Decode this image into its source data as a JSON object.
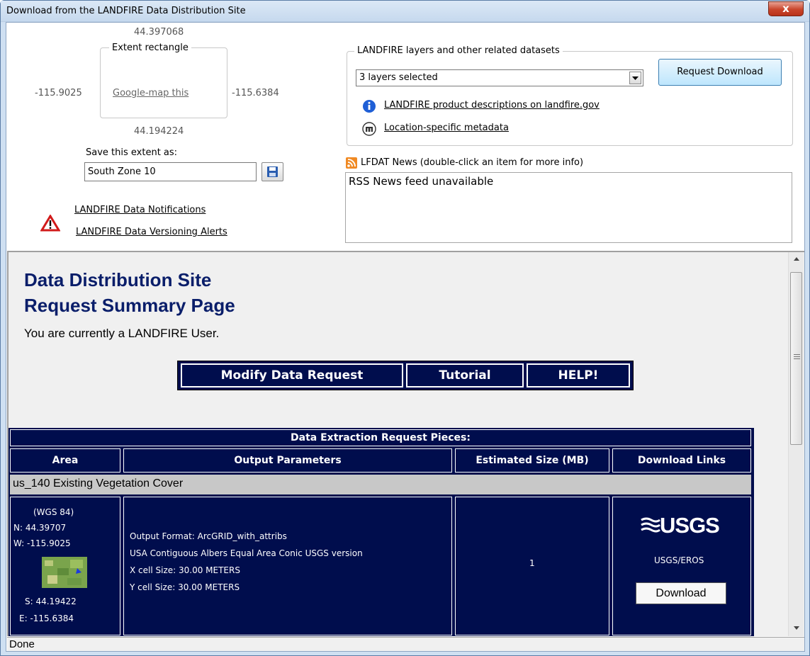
{
  "window": {
    "title": "Download from the LANDFIRE Data Distribution Site",
    "close_label": "x"
  },
  "extent": {
    "north": "44.397068",
    "south": "44.194224",
    "west": "-115.9025",
    "east": "-115.6384",
    "box_label": "Extent rectangle",
    "map_link": "Google-map this",
    "save_label": "Save this extent as:",
    "save_value": "South Zone 10"
  },
  "alerts": {
    "notifications": "LANDFIRE Data Notifications",
    "versioning": "LANDFIRE Data Versioning Alerts"
  },
  "layers": {
    "legend": "LANDFIRE layers and other related datasets",
    "selected": "3 layers selected",
    "request_button": "Request Download",
    "descriptions_link": "LANDFIRE product descriptions on landfire.gov",
    "metadata_link": "Location-specific metadata"
  },
  "news": {
    "label": "LFDAT News (double-click an item for more info)",
    "content": "RSS News feed unavailable"
  },
  "page": {
    "title_line1": "Data Distribution Site",
    "title_line2": "Request Summary Page",
    "user_line": "You are currently a LANDFIRE User.",
    "nav": {
      "modify": "Modify Data Request",
      "tutorial": "Tutorial",
      "help": "HELP!"
    }
  },
  "table": {
    "caption": "Data Extraction Request Pieces:",
    "headers": [
      "Area",
      "Output Parameters",
      "Estimated Size (MB)",
      "Download Links"
    ],
    "layer_name": "us_140 Existing Vegetation Cover",
    "area": {
      "datum": "(WGS 84)",
      "n": "N: 44.39707",
      "w": "W: -115.9025",
      "s": "S: 44.19422",
      "e": "E: -115.6384"
    },
    "params": [
      "Output Format: ArcGRID_with_attribs",
      "USA Contiguous Albers Equal Area Conic USGS version",
      "X cell Size: 30.00 METERS",
      "Y cell Size: 30.00 METERS"
    ],
    "size": "1",
    "logo_text": "USGS",
    "provider": "USGS/EROS",
    "download_button": "Download"
  },
  "status": {
    "text": "Done"
  },
  "colors": {
    "navy": "#000d4d",
    "title_blue": "#0a1e6a"
  }
}
